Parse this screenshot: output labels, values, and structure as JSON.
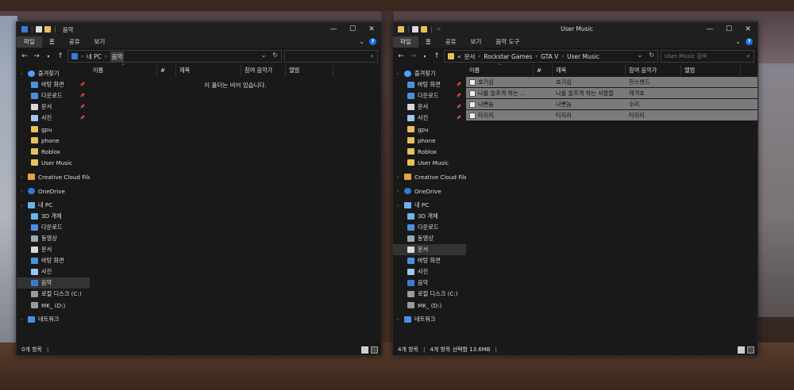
{
  "left_window": {
    "title": "음악",
    "ribbon_tabs": [
      "파일",
      "홈",
      "공유",
      "보기"
    ],
    "breadcrumb": [
      "내 PC",
      "음악"
    ],
    "search_placeholder": "",
    "nav": [
      {
        "label": "즐겨찾기",
        "icon": "star-icon",
        "kind": "header"
      },
      {
        "label": "바탕 화면",
        "icon": "desktop-folder-icon",
        "pinned": true
      },
      {
        "label": "다운로드",
        "icon": "download-arrow-icon",
        "pinned": true
      },
      {
        "label": "문서",
        "icon": "document-folder-icon",
        "pinned": true
      },
      {
        "label": "사진",
        "icon": "pictures-folder-icon",
        "pinned": true
      },
      {
        "label": "gpu",
        "icon": "folder-icon"
      },
      {
        "label": "phone",
        "icon": "folder-icon"
      },
      {
        "label": "Roblox",
        "icon": "folder-icon"
      },
      {
        "label": "User Music",
        "icon": "folder-icon"
      },
      {
        "label": "Creative Cloud Files",
        "icon": "creative-cloud-icon",
        "kind": "header"
      },
      {
        "label": "OneDrive",
        "icon": "onedrive-cloud-icon",
        "kind": "header"
      },
      {
        "label": "내 PC",
        "icon": "pc-icon",
        "kind": "header"
      },
      {
        "label": "3D 개체",
        "icon": "3d-objects-icon"
      },
      {
        "label": "다운로드",
        "icon": "download-arrow-icon"
      },
      {
        "label": "동영상",
        "icon": "videos-folder-icon"
      },
      {
        "label": "문서",
        "icon": "document-folder-icon"
      },
      {
        "label": "바탕 화면",
        "icon": "desktop-folder-icon"
      },
      {
        "label": "사진",
        "icon": "pictures-folder-icon"
      },
      {
        "label": "음악",
        "icon": "music-note-icon",
        "selected": true
      },
      {
        "label": "로컬 디스크 (C:)",
        "icon": "drive-icon"
      },
      {
        "label": "MK_ (D:)",
        "icon": "drive-icon"
      },
      {
        "label": "네트워크",
        "icon": "network-icon",
        "kind": "header"
      }
    ],
    "columns": [
      "이름",
      "#",
      "제목",
      "참여 음악가",
      "앨범"
    ],
    "empty_message": "이 폴더는 비어 있습니다.",
    "status": "0개 항목"
  },
  "right_window": {
    "title": "User Music",
    "ribbon_tabs": [
      "파일",
      "홈",
      "공유",
      "보기",
      "음악 도구"
    ],
    "breadcrumb": [
      "«",
      "문서",
      "Rockstar Games",
      "GTA V",
      "User Music"
    ],
    "search_placeholder": "User Music 검색",
    "nav": [
      {
        "label": "즐겨찾기",
        "icon": "star-icon",
        "kind": "header"
      },
      {
        "label": "바탕 화면",
        "icon": "desktop-folder-icon",
        "pinned": true
      },
      {
        "label": "다운로드",
        "icon": "download-arrow-icon",
        "pinned": true
      },
      {
        "label": "문서",
        "icon": "document-folder-icon",
        "pinned": true
      },
      {
        "label": "사진",
        "icon": "pictures-folder-icon",
        "pinned": true
      },
      {
        "label": "gpu",
        "icon": "folder-icon"
      },
      {
        "label": "phone",
        "icon": "folder-icon"
      },
      {
        "label": "Roblox",
        "icon": "folder-icon"
      },
      {
        "label": "User Music",
        "icon": "folder-icon"
      },
      {
        "label": "Creative Cloud Files",
        "icon": "creative-cloud-icon",
        "kind": "header"
      },
      {
        "label": "OneDrive",
        "icon": "onedrive-cloud-icon",
        "kind": "header"
      },
      {
        "label": "내 PC",
        "icon": "pc-icon",
        "kind": "header"
      },
      {
        "label": "3D 개체",
        "icon": "3d-objects-icon"
      },
      {
        "label": "다운로드",
        "icon": "download-arrow-icon"
      },
      {
        "label": "동영상",
        "icon": "videos-folder-icon"
      },
      {
        "label": "문서",
        "icon": "document-folder-icon",
        "selected": true
      },
      {
        "label": "바탕 화면",
        "icon": "desktop-folder-icon"
      },
      {
        "label": "사진",
        "icon": "pictures-folder-icon"
      },
      {
        "label": "음악",
        "icon": "music-note-icon"
      },
      {
        "label": "로컬 디스크 (C:)",
        "icon": "drive-icon"
      },
      {
        "label": "MK_ (D:)",
        "icon": "drive-icon"
      },
      {
        "label": "네트워크",
        "icon": "network-icon",
        "kind": "header"
      }
    ],
    "columns": [
      "이름",
      "#",
      "제목",
      "참여 음악가",
      "앨범"
    ],
    "files": [
      {
        "name": "호기심",
        "number": "",
        "title": "호기심",
        "artist": "한스밴드",
        "album": ""
      },
      {
        "name": "나를 슬프게 하는 ...",
        "number": "",
        "title": "나를 슬프게 하는 사람들",
        "artist": "캐겨호",
        "album": ""
      },
      {
        "name": "나쁜놈",
        "number": "",
        "title": "나쁜놈",
        "artist": "수리",
        "album": ""
      },
      {
        "name": "타지리",
        "number": "",
        "title": "타지리",
        "artist": "타지리",
        "album": ""
      }
    ],
    "status_count": "4개 항목",
    "status_selected": "4개 항목 선택함 13.6MB"
  },
  "colors": {
    "window_bg": "#191919",
    "selection": "#7a7a7a",
    "accent": "#1a73e8",
    "folder": "#e8c05a"
  }
}
